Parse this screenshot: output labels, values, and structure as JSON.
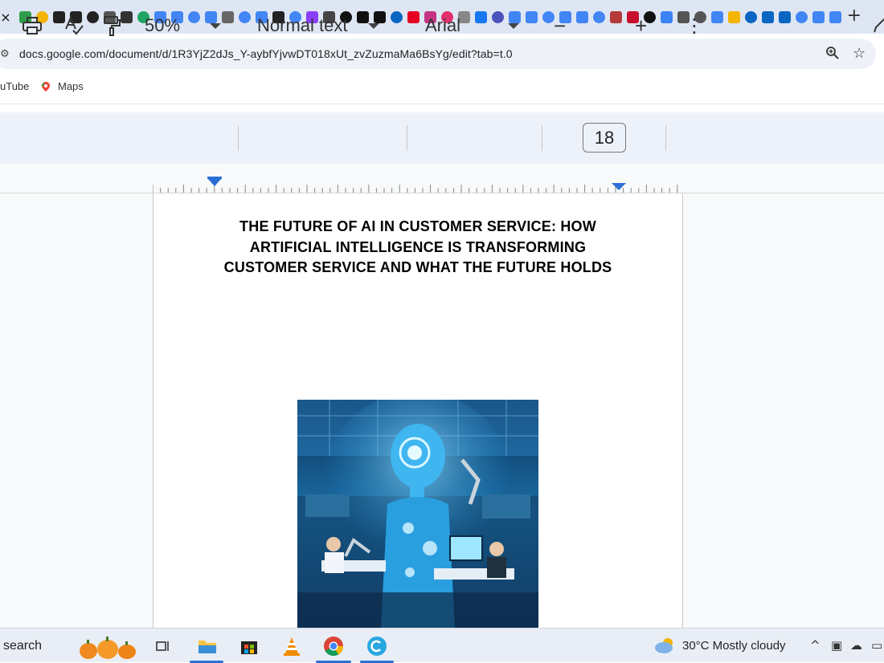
{
  "browser": {
    "tab_close_glyph": "×",
    "new_tab_glyph": "+",
    "url": "docs.google.com/document/d/1R3YjZ2dJs_Y-aybfYjvwDT018xUt_zvZuzmaMa6BsYg/edit?tab=t.0",
    "bookmarks": [
      {
        "label": "uTube"
      },
      {
        "label": "Maps"
      }
    ],
    "tab_favicon_colors": [
      "#2e9c4a",
      "#f4b400",
      "#222222",
      "#222222",
      "#222222",
      "#555555",
      "#333333",
      "#1fa463",
      "#4285f4",
      "#4285f4",
      "#4285f4",
      "#4285f4",
      "#666666",
      "#4285f4",
      "#4285f4",
      "#222222",
      "#4285f4",
      "#8a3ffc",
      "#444444",
      "#111111",
      "#111111",
      "#111111",
      "#0a66c2",
      "#e60023",
      "#c13584",
      "#e1306c",
      "#888888",
      "#1877f2",
      "#4b53bc",
      "#4285f4",
      "#4285f4",
      "#4285f4",
      "#4285f4",
      "#4285f4",
      "#4285f4",
      "#b53a3a",
      "#c8102e",
      "#111111",
      "#3b82f6",
      "#555555",
      "#555555",
      "#4285f4",
      "#f4b400",
      "#0a66c2",
      "#0a66c2",
      "#0a66c2",
      "#4285f4",
      "#4285f4",
      "#4285f4"
    ]
  },
  "toolbar": {
    "zoom": "50%",
    "style": "Normal text",
    "font": "Arial",
    "minus": "−",
    "font_size": "18",
    "plus": "+",
    "more": "⋮"
  },
  "document": {
    "title": "THE FUTURE OF AI IN CUSTOMER SERVICE: HOW ARTIFICIAL INTELLIGENCE IS TRANSFORMING CUSTOMER SERVICE AND WHAT THE FUTURE HOLDS"
  },
  "taskbar": {
    "search_label": "search",
    "weather": "30°C  Mostly cloudy"
  },
  "colors": {
    "accent": "#2b6fd6",
    "toolbar_bg": "#edf2fa",
    "image_blue": "#1e8fd6"
  }
}
